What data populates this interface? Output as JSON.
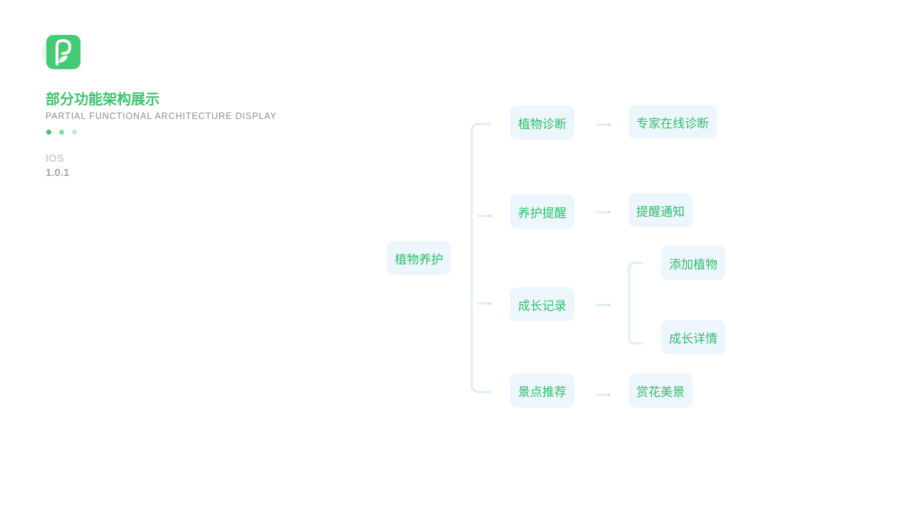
{
  "header": {
    "title_cn": "部分功能架构展示",
    "title_en": "PARTIAL FUNCTIONAL ARCHITECTURE DISPLAY",
    "platform": "IOS",
    "version": "1.0.1"
  },
  "logo": {
    "icon": "leaf-p-logo-icon",
    "color": "#3cc46e"
  },
  "dots": [
    "#3cc46e",
    "#7fdcaa",
    "#b8ecd3"
  ],
  "colors": {
    "accent": "#3cc46e",
    "node_bg": "#eef6fd",
    "node_text": "#2ebf6a",
    "connector": "#deedf9"
  },
  "tree": {
    "root": "植物养护",
    "children": [
      {
        "label": "植物诊断",
        "children": [
          "专家在线诊断"
        ]
      },
      {
        "label": "养护提醒",
        "children": [
          "提醒通知"
        ]
      },
      {
        "label": "成长记录",
        "children": [
          "添加植物",
          "成长详情"
        ]
      },
      {
        "label": "景点推荐",
        "children": [
          "赏花美景"
        ]
      }
    ]
  }
}
